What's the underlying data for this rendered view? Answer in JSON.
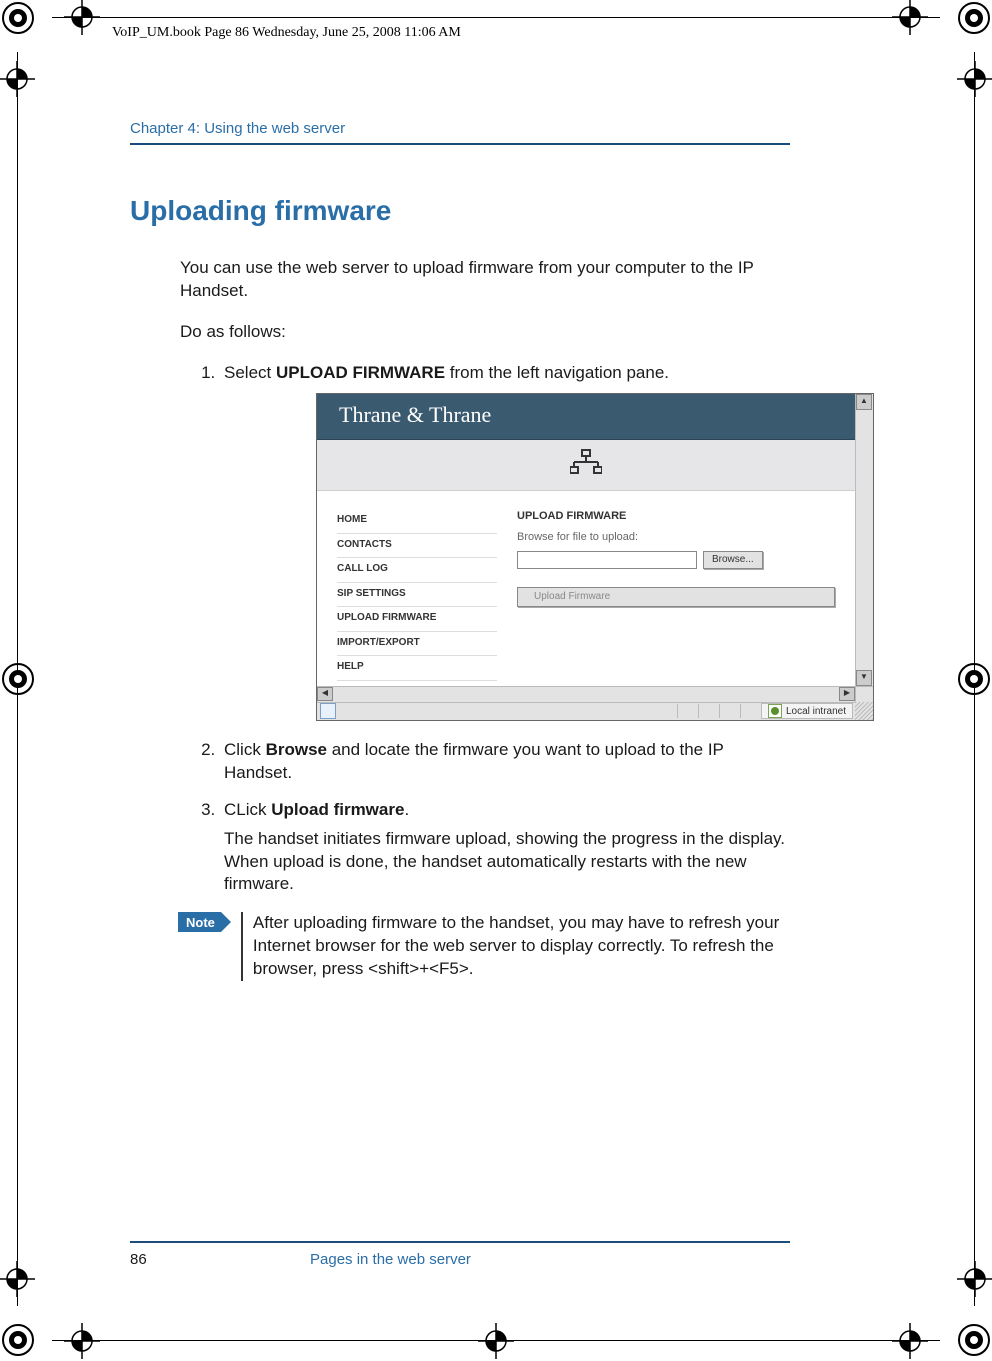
{
  "runhead": "VoIP_UM.book  Page 86  Wednesday, June 25, 2008  11:06 AM",
  "chapter_line": "Chapter 4:  Using the web server",
  "heading": "Uploading firmware",
  "intro_line1": "You can use the web server to upload firmware from your computer to the IP Handset.",
  "intro_line2": "Do as follows:",
  "step1_pre": "Select ",
  "step1_bold": "UPLOAD FIRMWARE",
  "step1_post": " from the left navigation pane.",
  "step2_pre": "Click ",
  "step2_bold": "Browse",
  "step2_post": " and locate the firmware you want to upload to the IP Handset.",
  "step3_pre": "CLick ",
  "step3_bold": "Upload firmware",
  "step3_post": ".",
  "step3_sub": "The handset initiates firmware upload, showing the progress in the display. When upload is done, the handset automatically restarts with the new firmware.",
  "note_label": "Note",
  "note_text": "After uploading firmware to the handset, you may have to refresh your Internet browser for the web server to display correctly. To refresh the browser, press <shift>+<F5>.",
  "screenshot": {
    "brand": "Thrane & Thrane",
    "nav": [
      "HOME",
      "CONTACTS",
      "CALL LOG",
      "SIP SETTINGS",
      "UPLOAD FIRMWARE",
      "IMPORT/EXPORT",
      "HELP"
    ],
    "panel_title": "UPLOAD FIRMWARE",
    "panel_sub": "Browse for file to upload:",
    "browse_label": "Browse...",
    "upload_label": "Upload Firmware",
    "zone_label": "Local intranet"
  },
  "footer_page": "86",
  "footer_title": "Pages in the web server"
}
